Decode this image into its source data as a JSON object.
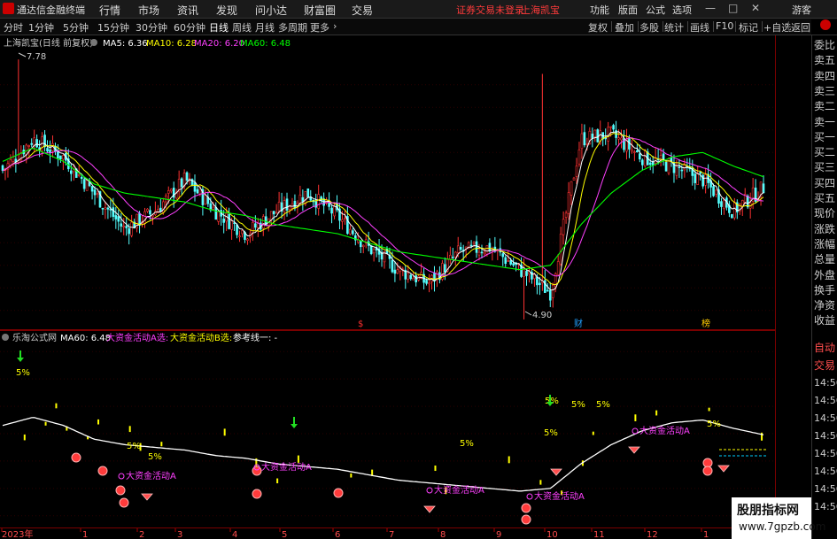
{
  "titlebar": {
    "app_name": "通达信金融终端",
    "menus": [
      "行情",
      "市场",
      "资讯",
      "发现",
      "问小达",
      "财富圈",
      "交易"
    ],
    "notice": "证券交易未登录",
    "stock_name": "上海凯宝",
    "right_menus": [
      "功能",
      "版面",
      "公式",
      "选项"
    ],
    "guest": "游客"
  },
  "periodbar": {
    "periods": [
      "分时",
      "1分钟",
      "5分钟",
      "15分钟",
      "30分钟",
      "60分钟",
      "日线",
      "周线",
      "月线",
      "多周期",
      "更多"
    ],
    "active_period": "日线",
    "tools": [
      "复权",
      "叠加",
      "多股",
      "统计",
      "画线",
      "F10",
      "标记",
      "+自选",
      "返回"
    ]
  },
  "main_chart": {
    "title": "上海凯宝(日线 前复权)",
    "ma_labels": [
      {
        "text": "MA5: 6.36",
        "color": "#ffffff"
      },
      {
        "text": "MA10: 6.28",
        "color": "#ffff00"
      },
      {
        "text": "MA20: 6.20",
        "color": "#ff40ff"
      },
      {
        "text": "MA60: 6.48",
        "color": "#00ff00"
      }
    ],
    "y_ticks": [
      "7.50",
      "7.25",
      "7.00",
      "6.75",
      "6.50",
      "6.25",
      "6.00",
      "5.75",
      "5.50",
      "5.25",
      "5.00"
    ],
    "high_label": "7.78",
    "low_label": "4.90",
    "markers": [
      {
        "text": "$",
        "color": "#ff3030"
      },
      {
        "text": "财",
        "color": "#20a0ff"
      },
      {
        "text": "榜",
        "color": "#ffcc00"
      }
    ]
  },
  "sub_chart": {
    "title": "乐淘公式网",
    "labels": [
      {
        "text": "MA60: 6.48",
        "color": "#ffffff"
      },
      {
        "text": "大资金活动A选:",
        "color": "#ff40ff"
      },
      {
        "text": "大资金活动B选:",
        "color": "#ffff00"
      },
      {
        "text": "参考线一: -",
        "color": "#ffffff"
      }
    ],
    "y_ticks": [
      "8.00",
      "7.50",
      "7.00",
      "6.50",
      "6.00",
      "5.50",
      "5.00"
    ],
    "pct_label": "5%",
    "signal_label": "大资金活动A"
  },
  "x_axis": {
    "labels": [
      "2023年",
      "1",
      "2",
      "3",
      "4",
      "5",
      "6",
      "7",
      "8",
      "9",
      "10",
      "11",
      "12",
      "1",
      "2"
    ]
  },
  "right_panel": {
    "top_labels": [
      "委比",
      "卖五",
      "卖四",
      "卖三",
      "卖二",
      "卖一",
      "买一",
      "买二",
      "买三",
      "买四",
      "买五",
      "现价",
      "涨跌",
      "涨幅",
      "总量",
      "外盘",
      "换手",
      "净资",
      "收益"
    ],
    "bottom_labels": [
      "自动",
      "交易",
      "14:56",
      "14:56",
      "14:56",
      "14:56",
      "14:56",
      "14:56",
      "14:56",
      "14:56"
    ]
  },
  "watermark": {
    "line1": "股朋指标网",
    "line2": "www.7gpzb.com"
  },
  "chart_data": {
    "type": "candlestick",
    "title": "上海凯宝(日线 前复权)",
    "xlabel": "",
    "ylabel": "",
    "ylim": [
      4.85,
      7.85
    ],
    "x_months": [
      "2023年",
      "1",
      "2",
      "3",
      "4",
      "5",
      "6",
      "7",
      "8",
      "9",
      "10",
      "11",
      "12",
      "1",
      "2"
    ],
    "series": [
      {
        "name": "MA5",
        "approx_close_path": [
          6.55,
          6.9,
          6.7,
          6.3,
          5.9,
          6.1,
          6.45,
          6.1,
          5.85,
          6.1,
          6.3,
          6.05,
          5.7,
          5.45,
          5.3,
          5.65,
          5.7,
          5.45,
          5.2,
          6.9,
          6.95,
          6.7,
          6.6,
          6.45,
          6.1,
          6.36
        ]
      },
      {
        "name": "MA60",
        "approx_close_path": [
          6.65,
          6.8,
          6.65,
          6.4,
          6.3,
          6.25,
          6.2,
          6.1,
          6.05,
          5.95,
          5.9,
          5.85,
          5.75,
          5.65,
          5.6,
          5.55,
          5.5,
          5.45,
          5.5,
          5.95,
          6.3,
          6.55,
          6.7,
          6.75,
          6.6,
          6.48
        ]
      }
    ],
    "high": 7.78,
    "low": 4.9
  }
}
